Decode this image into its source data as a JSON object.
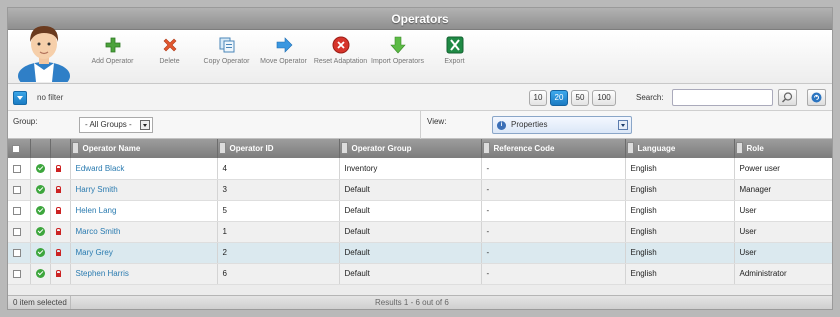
{
  "window": {
    "title": "Operators"
  },
  "toolbar": {
    "items": [
      {
        "label": "Add Operator",
        "icon": "plus-icon"
      },
      {
        "label": "Delete",
        "icon": "x-icon"
      },
      {
        "label": "Copy Operator",
        "icon": "copy-icon"
      },
      {
        "label": "Move Operator",
        "icon": "arrow-right-icon"
      },
      {
        "label": "Reset Adaptation",
        "icon": "reset-icon"
      },
      {
        "label": "Import Operators",
        "icon": "arrow-down-icon"
      },
      {
        "label": "Export",
        "icon": "excel-icon"
      }
    ]
  },
  "filter": {
    "text": "no filter",
    "page_sizes": [
      "10",
      "20",
      "50",
      "100"
    ],
    "active_page_size": "20",
    "search_label": "Search:",
    "search_value": ""
  },
  "group": {
    "label": "Group:",
    "value": "- All Groups -"
  },
  "view": {
    "label": "View:",
    "value": "Properties"
  },
  "table": {
    "columns": [
      "Operator Name",
      "Operator ID",
      "Operator Group",
      "Reference Code",
      "Language",
      "Role"
    ],
    "rows": [
      {
        "name": "Edward Black",
        "id": "4",
        "group": "Inventory",
        "ref": "-",
        "language": "English",
        "role": "Power user"
      },
      {
        "name": "Harry Smith",
        "id": "3",
        "group": "Default",
        "ref": "-",
        "language": "English",
        "role": "Manager"
      },
      {
        "name": "Helen Lang",
        "id": "5",
        "group": "Default",
        "ref": "-",
        "language": "English",
        "role": "User"
      },
      {
        "name": "Marco Smith",
        "id": "1",
        "group": "Default",
        "ref": "-",
        "language": "English",
        "role": "User"
      },
      {
        "name": "Mary Grey",
        "id": "2",
        "group": "Default",
        "ref": "-",
        "language": "English",
        "role": "User"
      },
      {
        "name": "Stephen Harris",
        "id": "6",
        "group": "Default",
        "ref": "-",
        "language": "English",
        "role": "Administrator"
      }
    ]
  },
  "footer": {
    "selected": "0 item selected",
    "results": "Results 1 - 6 out of 6"
  },
  "colors": {
    "accent": "#1b7bc2",
    "link": "#2a7bb0",
    "highlight_row": "#dbe9ef"
  }
}
